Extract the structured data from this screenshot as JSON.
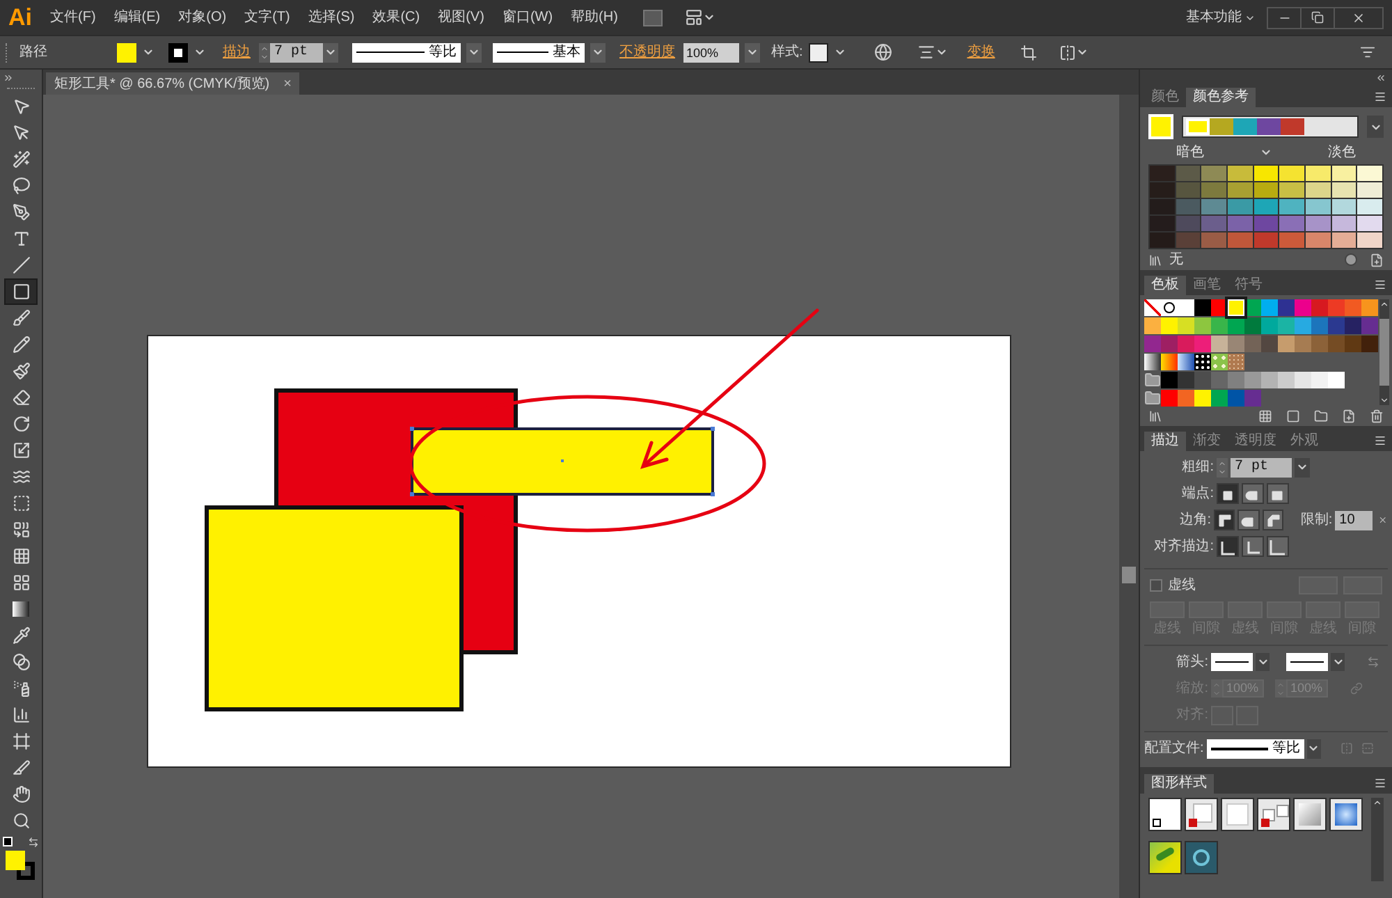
{
  "menu_bar": {
    "logo": "Ai",
    "menus": [
      "文件(F)",
      "编辑(E)",
      "对象(O)",
      "文字(T)",
      "选择(S)",
      "效果(C)",
      "视图(V)",
      "窗口(W)",
      "帮助(H)"
    ],
    "workspace": "基本功能"
  },
  "control_bar": {
    "object_type": "路径",
    "fill_swatch": {
      "color": "#fff200"
    },
    "stroke_swatch": {
      "color": "#000000"
    },
    "stroke_label": "描边",
    "stroke_weight": "7 pt",
    "profile": "等比",
    "brush": "基本",
    "opacity_label": "不透明度",
    "opacity": "100%",
    "style_label": "样式:",
    "transform_label": "变换"
  },
  "document_tab": {
    "title": "矩形工具* @ 66.67% (CMYK/预览)",
    "close": "×"
  },
  "tools": [
    {
      "kind": "selection",
      "selected": false
    },
    {
      "kind": "direct",
      "selected": false
    },
    {
      "kind": "wand",
      "selected": false
    },
    {
      "kind": "lasso",
      "selected": false
    },
    {
      "kind": "pen",
      "selected": false
    },
    {
      "kind": "type",
      "selected": false
    },
    {
      "kind": "line",
      "selected": false
    },
    {
      "kind": "rectangle",
      "selected": true
    },
    {
      "kind": "brush",
      "selected": false
    },
    {
      "kind": "pencil",
      "selected": false
    },
    {
      "kind": "blob",
      "selected": false
    },
    {
      "kind": "eraser",
      "selected": false
    },
    {
      "kind": "rotate",
      "selected": false
    },
    {
      "kind": "scale",
      "selected": false
    },
    {
      "kind": "warp",
      "selected": false
    },
    {
      "kind": "transform",
      "selected": false
    },
    {
      "kind": "builder",
      "selected": false
    },
    {
      "kind": "perspective",
      "selected": false
    },
    {
      "kind": "mesh",
      "selected": false
    },
    {
      "kind": "gradient",
      "selected": false
    },
    {
      "kind": "eyedropper",
      "selected": false
    },
    {
      "kind": "blend",
      "selected": false
    },
    {
      "kind": "spray",
      "selected": false
    },
    {
      "kind": "graph",
      "selected": false
    },
    {
      "kind": "artboard",
      "selected": false
    },
    {
      "kind": "slice",
      "selected": false
    },
    {
      "kind": "hand",
      "selected": false
    },
    {
      "kind": "zoom",
      "selected": false
    }
  ],
  "fill_stroke": {
    "fill": {
      "color": "#fff200"
    },
    "stroke": {
      "color": "#000000"
    }
  },
  "color_panel": {
    "tabs": [
      {
        "label": "颜色",
        "selected": false
      },
      {
        "label": "颜色参考",
        "selected": true
      }
    ],
    "current": {
      "color": "#fff200"
    },
    "harmony": [
      {
        "color": "#fff200",
        "selected": true
      },
      {
        "color": "#b5a820",
        "selected": false
      },
      {
        "color": "#1ea6b6",
        "selected": false
      },
      {
        "color": "#6e47a0",
        "selected": false
      },
      {
        "color": "#c0392b",
        "selected": false
      }
    ],
    "dark_label": "暗色",
    "light_label": "淡色",
    "grid": [
      [
        {
          "color": "#2a1f1c"
        },
        {
          "color": "#5c5a48"
        },
        {
          "color": "#8e8a55"
        },
        {
          "color": "#c8bb3a"
        },
        {
          "color": "#f7e600"
        },
        {
          "color": "#f5e330"
        },
        {
          "color": "#f7ea6a"
        },
        {
          "color": "#f8f0a0"
        },
        {
          "color": "#fbf8d4"
        }
      ],
      [
        {
          "color": "#261d1a"
        },
        {
          "color": "#57553f"
        },
        {
          "color": "#7d7a3e"
        },
        {
          "color": "#a8a032"
        },
        {
          "color": "#b8ab10"
        },
        {
          "color": "#c8bf45"
        },
        {
          "color": "#dcd58a"
        },
        {
          "color": "#e7e3b0"
        },
        {
          "color": "#efedd6"
        }
      ],
      [
        {
          "color": "#231c1b"
        },
        {
          "color": "#4b5a60"
        },
        {
          "color": "#5e8a93"
        },
        {
          "color": "#3a9aa5"
        },
        {
          "color": "#1ea6b6"
        },
        {
          "color": "#4fb3c0"
        },
        {
          "color": "#86c6cf"
        },
        {
          "color": "#b2d8dd"
        },
        {
          "color": "#d9ecee"
        }
      ],
      [
        {
          "color": "#241c1c"
        },
        {
          "color": "#4e4a5c"
        },
        {
          "color": "#6b5e8c"
        },
        {
          "color": "#7b62a8"
        },
        {
          "color": "#6e47a0"
        },
        {
          "color": "#8a6fb6"
        },
        {
          "color": "#a793c8"
        },
        {
          "color": "#c6b8dc"
        },
        {
          "color": "#e2daee"
        }
      ],
      [
        {
          "color": "#241b19"
        },
        {
          "color": "#5a4038"
        },
        {
          "color": "#9a5c46"
        },
        {
          "color": "#c0573a"
        },
        {
          "color": "#c0392b"
        },
        {
          "color": "#cc5a3a"
        },
        {
          "color": "#d8866a"
        },
        {
          "color": "#e4ad96"
        },
        {
          "color": "#f0d5c8"
        }
      ]
    ],
    "none_label": "无"
  },
  "swatches_panel": {
    "tabs": [
      {
        "label": "色板",
        "selected": true
      },
      {
        "label": "画笔",
        "selected": false
      },
      {
        "label": "符号",
        "selected": false
      }
    ],
    "rows": [
      [
        {
          "kind": "none",
          "selected": false
        },
        {
          "kind": "registration",
          "selected": false
        },
        {
          "kind": "color",
          "color": "#ffffff",
          "selected": false
        },
        {
          "kind": "color",
          "color": "#000000",
          "selected": false
        },
        {
          "kind": "color",
          "color": "#ff0000",
          "selected": false
        },
        {
          "kind": "color",
          "color": "#fff200",
          "selected": true
        },
        {
          "kind": "color",
          "color": "#00a651",
          "selected": false
        },
        {
          "kind": "color",
          "color": "#00aeef",
          "selected": false
        },
        {
          "kind": "color",
          "color": "#2e3192",
          "selected": false
        },
        {
          "kind": "color",
          "color": "#ec008c",
          "selected": false
        },
        {
          "kind": "color",
          "color": "#d71920",
          "selected": false
        },
        {
          "kind": "color",
          "color": "#ed3a24",
          "selected": false
        },
        {
          "kind": "color",
          "color": "#f15a22",
          "selected": false
        },
        {
          "kind": "color",
          "color": "#f7941d",
          "selected": false
        }
      ],
      [
        {
          "kind": "color",
          "color": "#fbb040",
          "selected": false
        },
        {
          "kind": "color",
          "color": "#fff200",
          "selected": false
        },
        {
          "kind": "color",
          "color": "#d7df23",
          "selected": false
        },
        {
          "kind": "color",
          "color": "#8dc63f",
          "selected": false
        },
        {
          "kind": "color",
          "color": "#39b54a",
          "selected": false
        },
        {
          "kind": "color",
          "color": "#00a651",
          "selected": false
        },
        {
          "kind": "color",
          "color": "#007a3d",
          "selected": false
        },
        {
          "kind": "color",
          "color": "#00a99d",
          "selected": false
        },
        {
          "kind": "color",
          "color": "#1bb4a4",
          "selected": false
        },
        {
          "kind": "color",
          "color": "#27aae1",
          "selected": false
        },
        {
          "kind": "color",
          "color": "#1c75bc",
          "selected": false
        },
        {
          "kind": "color",
          "color": "#2b3990",
          "selected": false
        },
        {
          "kind": "color",
          "color": "#262262",
          "selected": false
        },
        {
          "kind": "color",
          "color": "#662d91",
          "selected": false
        }
      ],
      [
        {
          "kind": "color",
          "color": "#92278f",
          "selected": false
        },
        {
          "kind": "color",
          "color": "#9e1f63",
          "selected": false
        },
        {
          "kind": "color",
          "color": "#d91b5c",
          "selected": false
        },
        {
          "kind": "color",
          "color": "#ed1e79",
          "selected": false
        },
        {
          "kind": "color",
          "color": "#c7b299",
          "selected": false
        },
        {
          "kind": "color",
          "color": "#998675",
          "selected": false
        },
        {
          "kind": "color",
          "color": "#736357",
          "selected": false
        },
        {
          "kind": "color",
          "color": "#534741",
          "selected": false
        },
        {
          "kind": "color",
          "color": "#c69c6d",
          "selected": false
        },
        {
          "kind": "color",
          "color": "#a67c52",
          "selected": false
        },
        {
          "kind": "color",
          "color": "#8c6239",
          "selected": false
        },
        {
          "kind": "color",
          "color": "#754c24",
          "selected": false
        },
        {
          "kind": "color",
          "color": "#603913",
          "selected": false
        },
        {
          "kind": "color",
          "color": "#42210b",
          "selected": false
        }
      ],
      [
        {
          "kind": "gradient-gray",
          "selected": false
        },
        {
          "kind": "gradient-orange",
          "selected": false
        },
        {
          "kind": "gradient-blue",
          "selected": false
        },
        {
          "kind": "pattern-dots",
          "selected": false
        },
        {
          "kind": "pattern-leaf",
          "selected": false
        },
        {
          "kind": "pattern-texture",
          "selected": false
        }
      ],
      [
        {
          "kind": "folder",
          "selected": false
        },
        {
          "kind": "color",
          "color": "#000000",
          "selected": false
        },
        {
          "kind": "color",
          "color": "#333333",
          "selected": false
        },
        {
          "kind": "color",
          "color": "#4d4d4d",
          "selected": false
        },
        {
          "kind": "color",
          "color": "#666666",
          "selected": false
        },
        {
          "kind": "color",
          "color": "#808080",
          "selected": false
        },
        {
          "kind": "color",
          "color": "#999999",
          "selected": false
        },
        {
          "kind": "color",
          "color": "#b3b3b3",
          "selected": false
        },
        {
          "kind": "color",
          "color": "#cccccc",
          "selected": false
        },
        {
          "kind": "color",
          "color": "#e6e6e6",
          "selected": false
        },
        {
          "kind": "color",
          "color": "#f2f2f2",
          "selected": false
        },
        {
          "kind": "color",
          "color": "#ffffff",
          "selected": false
        }
      ],
      [
        {
          "kind": "folder",
          "selected": false
        },
        {
          "kind": "color",
          "color": "#ff0000",
          "selected": false
        },
        {
          "kind": "color",
          "color": "#f26522",
          "selected": false
        },
        {
          "kind": "color",
          "color": "#fff200",
          "selected": false
        },
        {
          "kind": "color",
          "color": "#00a651",
          "selected": false
        },
        {
          "kind": "color",
          "color": "#0054a6",
          "selected": false
        },
        {
          "kind": "color",
          "color": "#662d91",
          "selected": false
        }
      ]
    ]
  },
  "stroke_panel": {
    "tabs": [
      {
        "label": "描边",
        "selected": true
      },
      {
        "label": "渐变",
        "selected": false
      },
      {
        "label": "透明度",
        "selected": false
      },
      {
        "label": "外观",
        "selected": false
      }
    ],
    "weight_label": "粗细:",
    "weight": "7 pt",
    "cap_label": "端点:",
    "caps": [
      {
        "kind": "butt",
        "selected": true
      },
      {
        "kind": "round",
        "selected": false
      },
      {
        "kind": "projecting",
        "selected": false
      }
    ],
    "corner_label": "边角:",
    "corners": [
      {
        "kind": "miter",
        "selected": true
      },
      {
        "kind": "round",
        "selected": false
      },
      {
        "kind": "bevel",
        "selected": false
      }
    ],
    "limit_label": "限制:",
    "limit": "10",
    "align_label": "对齐描边:",
    "aligns": [
      {
        "kind": "center",
        "selected": true
      },
      {
        "kind": "inside",
        "selected": false
      },
      {
        "kind": "outside",
        "selected": false
      }
    ],
    "dashed_label": "虚线",
    "dashed": false,
    "dash_fields": [
      {
        "label": "虚线",
        "disabled": true
      },
      {
        "label": "间隙",
        "disabled": true
      },
      {
        "label": "虚线",
        "disabled": true
      },
      {
        "label": "间隙",
        "disabled": true
      },
      {
        "label": "虚线",
        "disabled": true
      },
      {
        "label": "间隙",
        "disabled": true
      }
    ],
    "arrow_label": "箭头:",
    "scale": {
      "label": "缩放:",
      "values": [
        "100%",
        "100%"
      ],
      "disabled": true
    },
    "arrow_align": {
      "label": "对齐:",
      "disabled": true
    },
    "profile_label": "配置文件:",
    "profile": "等比"
  },
  "graphic_styles": {
    "tabs": [
      {
        "label": "图形样式",
        "selected": true
      }
    ],
    "styles": [
      {
        "kind": "default"
      },
      {
        "kind": "no-fill-shadow"
      },
      {
        "kind": "plain"
      },
      {
        "kind": "no-fill-double"
      },
      {
        "kind": "gray-gradient"
      },
      {
        "kind": "blue-gradient"
      },
      {
        "kind": "leaf"
      },
      {
        "kind": "teal"
      }
    ]
  }
}
